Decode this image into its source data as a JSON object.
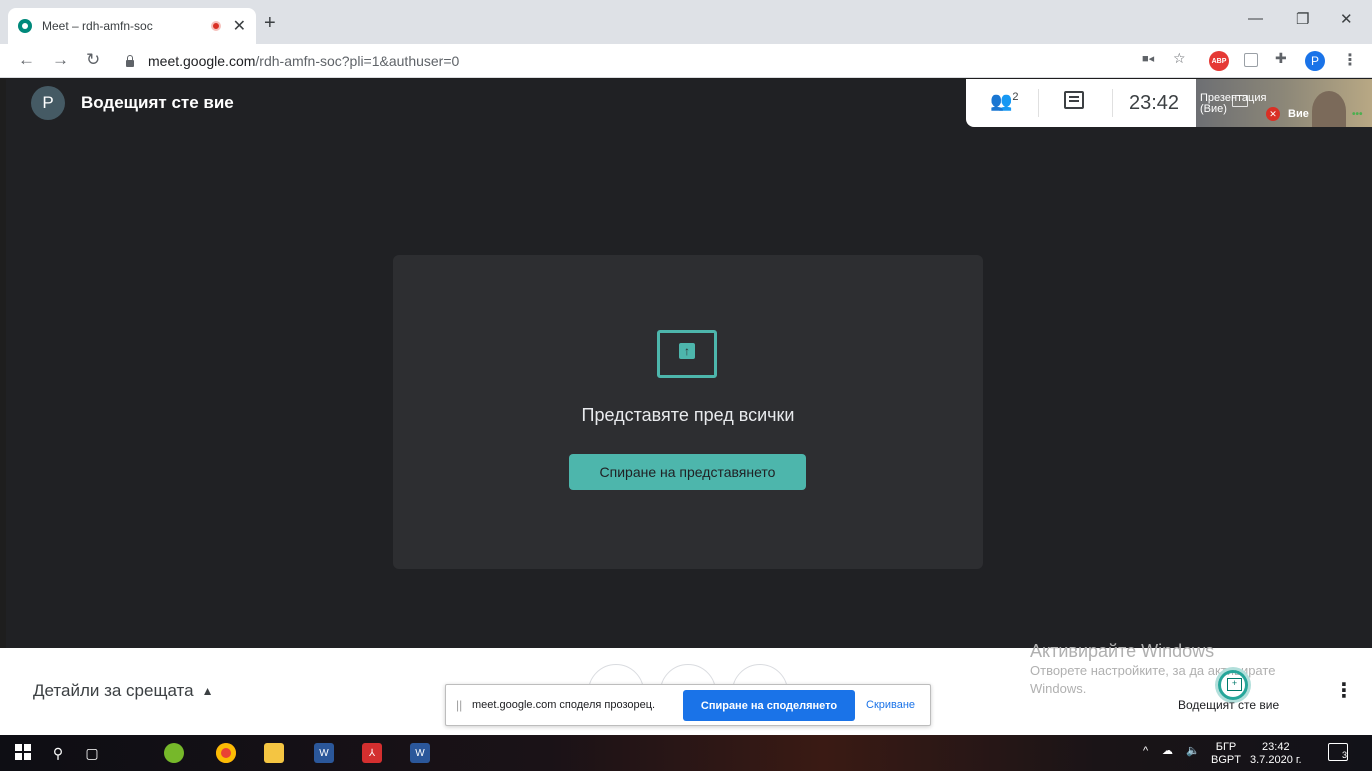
{
  "browser": {
    "tab_title": "Meet – rdh-amfn-soc",
    "new_tab": "+",
    "close_tab": "✕",
    "url_host": "meet.google.com",
    "url_path": "/rdh-amfn-soc?pli=1&authuser=0",
    "profile_initial": "P",
    "abp": "ABP",
    "minimize": "—",
    "restore": "❐",
    "close": "✕"
  },
  "meet": {
    "host_avatar_initial": "P",
    "host_label": "Водещият сте вие",
    "people_count": "2",
    "time": "23:42",
    "thumb_label_line1": "Презентация",
    "thumb_label_line2": "(Вие)",
    "thumb_name": "Вие",
    "presenting_heading": "Представяте пред всички",
    "stop_presenting_button": "Спиране на представянето",
    "meeting_details": "Детайли за срещата",
    "bottom_presenter_label": "Водещият сте вие"
  },
  "share_prompt": {
    "message": "meet.google.com споделя прозорец.",
    "stop_sharing": "Спиране на споделянето",
    "hide": "Скриване"
  },
  "windows_watermark": {
    "line1": "Активирайте Windows",
    "line2": "Отворете настройките, за да активирате",
    "line3": "Windows."
  },
  "taskbar": {
    "lang_top": "БГР",
    "lang_bottom": "BGPT",
    "clock_time": "23:42",
    "clock_date": "3.7.2020 г.",
    "notification_count": "3"
  },
  "colors": {
    "accent_teal": "#4db6ac",
    "google_blue": "#1a73e8",
    "stage_bg": "#202124",
    "card_bg": "#2d2e31"
  }
}
